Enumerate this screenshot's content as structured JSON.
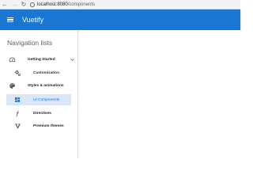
{
  "browser": {
    "back_icon": "arrow-left-icon",
    "forward_icon": "arrow-right-icon",
    "reload_icon": "reload-icon",
    "url_host": "localhost:8080",
    "url_path": "/components"
  },
  "app_bar": {
    "title": "Vuetify",
    "menu_icon": "hamburger-menu-icon",
    "color": "#1976d2"
  },
  "drawer": {
    "heading": "Navigation lists",
    "items": [
      {
        "label": "Getting Started",
        "icon": "speedometer-icon",
        "expandable": true
      },
      {
        "label": "Customization",
        "icon": "cogs-icon"
      },
      {
        "label": "Styles & animations",
        "icon": "palette-icon"
      },
      {
        "label": "UI Components",
        "icon": "view-dashboard-icon",
        "active": true
      },
      {
        "label": "Directives",
        "icon": "function-icon"
      },
      {
        "label": "Premium themes",
        "icon": "vuetify-logo-icon"
      }
    ],
    "active_color": "#1976d2",
    "active_bg": "#dbe7f7"
  }
}
